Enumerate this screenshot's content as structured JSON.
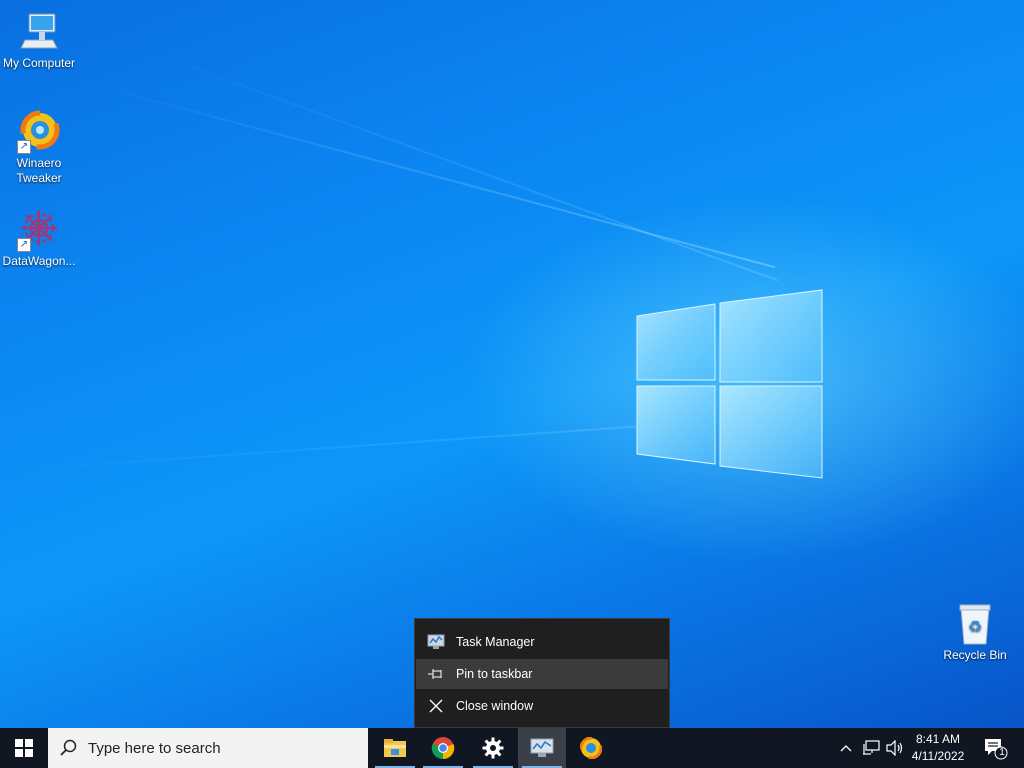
{
  "desktop": {
    "icons": [
      {
        "label": "My Computer",
        "icon": "computer-icon"
      },
      {
        "label": "Winaero Tweaker",
        "icon": "winaero-tweaker-icon"
      },
      {
        "label": "DataWagon...",
        "icon": "datawagon-icon"
      },
      {
        "label": "Recycle Bin",
        "icon": "recycle-bin-icon"
      }
    ]
  },
  "jumplist": {
    "items": [
      {
        "label": "Task Manager",
        "icon": "task-manager-icon"
      },
      {
        "label": "Pin to taskbar",
        "icon": "pin-icon"
      },
      {
        "label": "Close window",
        "icon": "close-icon"
      }
    ],
    "hovered_index": 1
  },
  "taskbar": {
    "search_placeholder": "Type here to search",
    "apps": [
      {
        "name": "File Explorer",
        "icon": "file-explorer-icon",
        "running": true
      },
      {
        "name": "Google Chrome",
        "icon": "chrome-icon",
        "running": true
      },
      {
        "name": "Settings",
        "icon": "settings-gear-icon",
        "running": true
      },
      {
        "name": "Task Manager",
        "icon": "task-manager-icon",
        "running": true,
        "active": true
      },
      {
        "name": "Winaero Tweaker",
        "icon": "winaero-tweaker-icon",
        "running": false
      }
    ],
    "tray": {
      "time": "8:41 AM",
      "date": "4/11/2022",
      "notification_count": "1"
    }
  },
  "colors": {
    "taskbar_bg": "#101722",
    "menu_bg": "#1f1f1f",
    "menu_hover": "#3b3b3b",
    "accent": "#0b86f2"
  }
}
